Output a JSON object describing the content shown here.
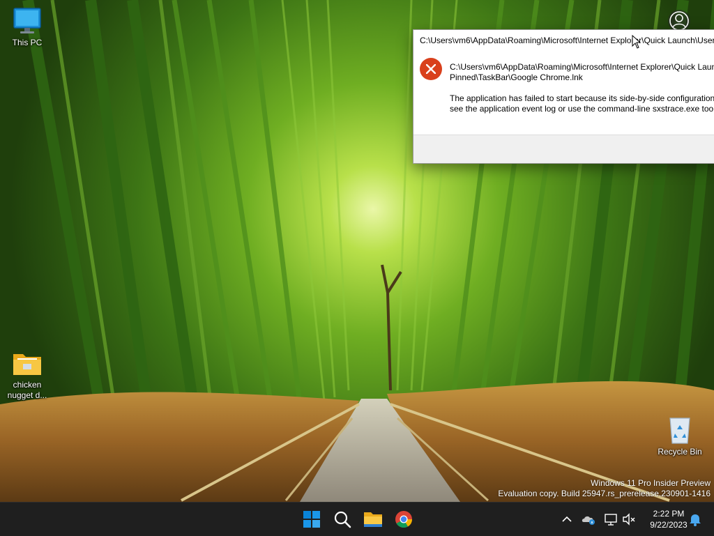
{
  "desktop": {
    "icons": [
      {
        "label": "This PC",
        "icon": "monitor-icon"
      },
      {
        "label": "chicken nugget d...",
        "icon": "folder-icon"
      },
      {
        "label": "Recycle Bin",
        "icon": "recycle-bin-icon"
      }
    ]
  },
  "error_dialog": {
    "title": "C:\\Users\\vm6\\AppData\\Roaming\\Microsoft\\Internet Explorer\\Quick Launch\\User",
    "message_line1": "C:\\Users\\vm6\\AppData\\Roaming\\Microsoft\\Internet Explorer\\Quick Laun",
    "message_line2": "Pinned\\TaskBar\\Google Chrome.lnk",
    "message_line3": "The application has failed to start because its side-by-side configuration",
    "message_line4": "see the application event log or use the command-line sxstrace.exe tool",
    "icon": "error-icon",
    "accent": "#d9401c"
  },
  "watermark": {
    "line1": "Windows 11 Pro Insider Preview",
    "line2": "Evaluation copy. Build 25947.rs_prerelease.230901-1416"
  },
  "taskbar": {
    "apps": [
      "start-icon",
      "search-icon",
      "file-explorer-icon",
      "chrome-icon"
    ],
    "tray_icons": [
      "chevron-up-icon",
      "onedrive-icon",
      "network-icon",
      "volume-muted-icon",
      "bell-icon"
    ],
    "time": "2:22 PM",
    "date": "9/22/2023"
  },
  "colors": {
    "taskbar_bg": "#1f1f1f",
    "windows_blue": "#0a84d8",
    "error_red": "#d9401c"
  }
}
